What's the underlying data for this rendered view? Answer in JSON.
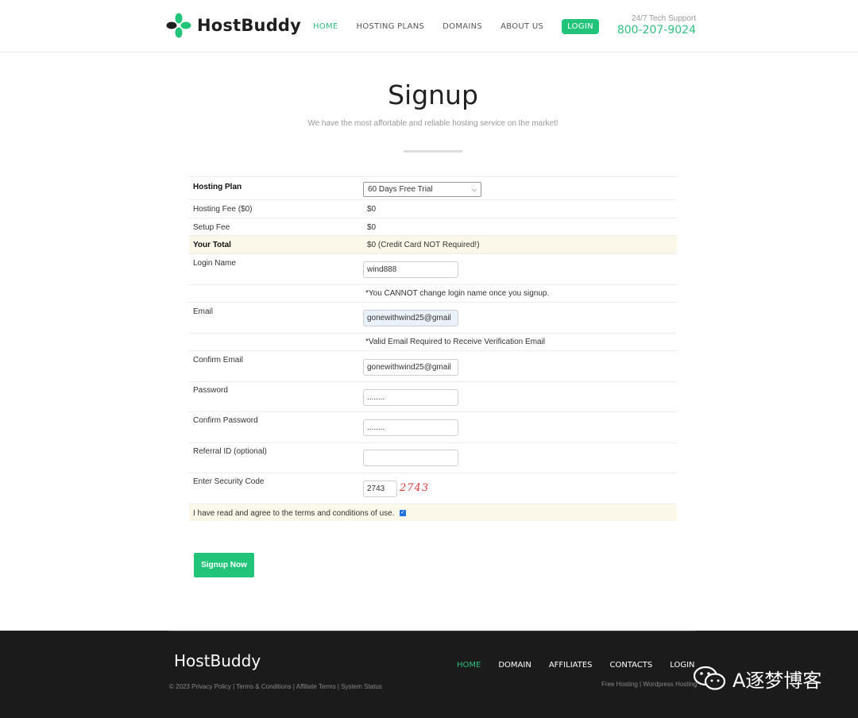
{
  "brand": {
    "name": "HostBuddy",
    "accent": "#22c47a"
  },
  "nav": {
    "items": [
      {
        "label": "HOME",
        "active": true
      },
      {
        "label": "HOSTING PLANS",
        "active": false
      },
      {
        "label": "DOMAINS",
        "active": false
      },
      {
        "label": "ABOUT US",
        "active": false
      }
    ],
    "login": "LOGIN"
  },
  "support": {
    "label": "24/7 Tech Support",
    "phone": "800-207-9024"
  },
  "page": {
    "title": "Signup",
    "subtitle": "We have the most affortable and reliable hosting service on the market!"
  },
  "form": {
    "hosting_plan": {
      "label": "Hosting Plan",
      "selected": "60 Days Free Trial"
    },
    "hosting_fee": {
      "label": "Hosting Fee ($0)",
      "value": "$0"
    },
    "setup_fee": {
      "label": "Setup Fee",
      "value": "$0"
    },
    "total": {
      "label": "Your Total",
      "value": "$0 (Credit Card NOT Required!)"
    },
    "login_name": {
      "label": "Login Name",
      "value": "wind888",
      "note": "*You CANNOT change login name once you signup."
    },
    "email": {
      "label": "Email",
      "value": "gonewithwind25@gmail",
      "note": "*Valid Email Required to Receive Verification Email"
    },
    "confirm_email": {
      "label": "Confirm Email",
      "value": "gonewithwind25@gmail"
    },
    "password": {
      "label": "Password",
      "value": "........"
    },
    "confirm_password": {
      "label": "Confirm Password",
      "value": "........"
    },
    "referral": {
      "label": "Referral ID (optional)",
      "value": ""
    },
    "security": {
      "label": "Enter Security Code",
      "value": "2743",
      "captcha": "2743"
    },
    "terms": {
      "label": "I have read and agree to the terms and conditions of use.",
      "checked": true
    },
    "submit": "Signup Now"
  },
  "footer": {
    "logo": "HostBuddy",
    "links": "© 2023 Privacy Policy | Terms & Conditions | Affiliate Terms | System Status",
    "nav": [
      {
        "label": "HOME",
        "active": true
      },
      {
        "label": "DOMAIN",
        "active": false
      },
      {
        "label": "AFFILIATES",
        "active": false
      },
      {
        "label": "CONTACTS",
        "active": false
      },
      {
        "label": "LOGIN",
        "active": false
      }
    ],
    "sub": "Free Hosting | Wordpress Hosting",
    "watermark": "A逐梦博客"
  }
}
